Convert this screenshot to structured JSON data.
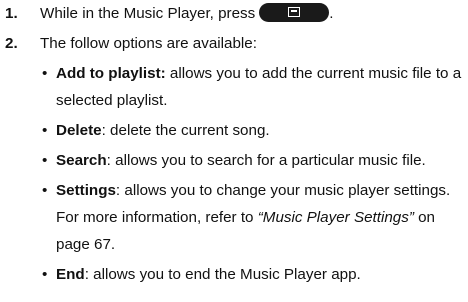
{
  "steps": [
    {
      "number": "1.",
      "text_before": "While in the Music Player, press",
      "text_after": ".",
      "key_icon": "menu-key-icon"
    },
    {
      "number": "2.",
      "text": "The follow options are available:"
    }
  ],
  "options": [
    {
      "term": "Add to playlist",
      "separator": ":",
      "description": " allows you to add the current music file to a selected playlist."
    },
    {
      "term": "Delete",
      "separator": ":",
      "description": " delete the current song."
    },
    {
      "term": "Search",
      "separator": ":",
      "description": " allows you to search for a particular music file."
    },
    {
      "term": "Settings",
      "separator": ":",
      "description_before": " allows you to change your music player settings. For more information, refer to ",
      "reference": "“Music Player Settings”",
      "description_after": " on page 67."
    },
    {
      "term": "End",
      "separator": ":",
      "description": " allows you to end the Music Player app."
    }
  ],
  "bullet_char": "•"
}
